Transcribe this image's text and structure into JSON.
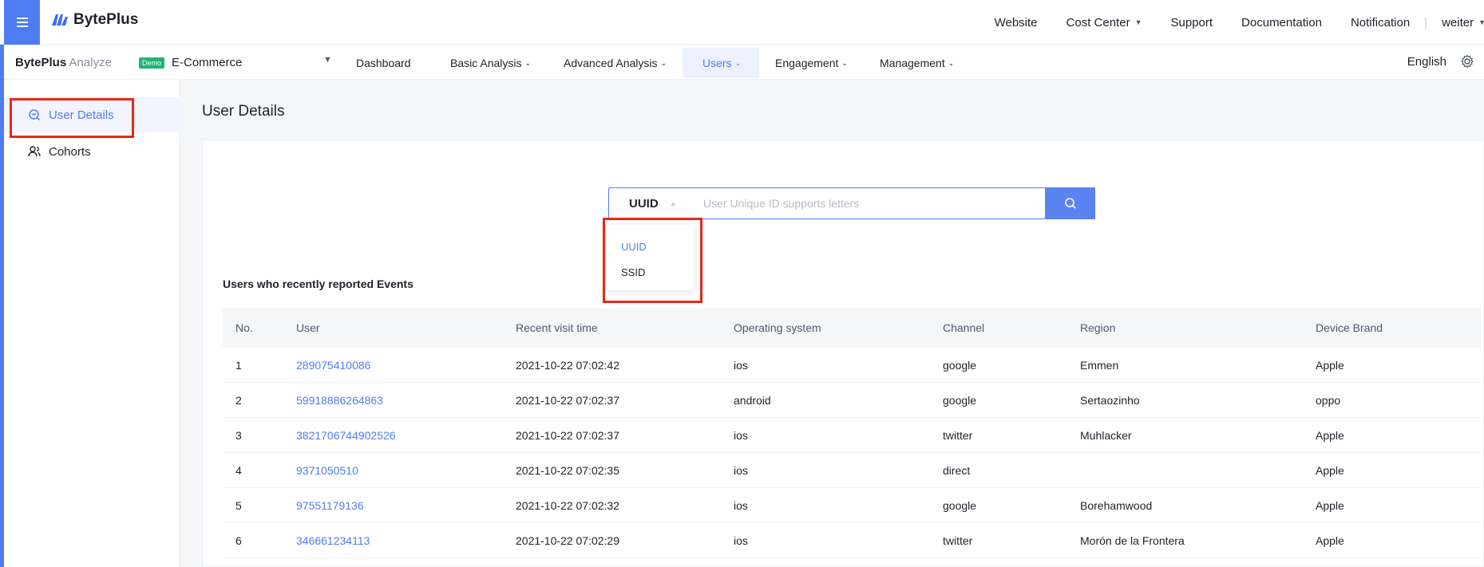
{
  "topbar": {
    "logo_text": "BytePlus",
    "nav": [
      {
        "label": "Website",
        "caret": false
      },
      {
        "label": "Cost Center",
        "caret": true
      },
      {
        "label": "Support",
        "caret": false
      },
      {
        "label": "Documentation",
        "caret": false
      },
      {
        "label": "Notification",
        "caret": false
      }
    ],
    "separator": "|",
    "user": "weiter"
  },
  "subbar": {
    "brand_bold": "BytePlus",
    "brand_light": "Analyze",
    "demo_badge": "Demo",
    "project": "E-Commerce",
    "nav": [
      {
        "label": "Dashboard",
        "chevron": false,
        "active": false
      },
      {
        "label": "Basic Analysis",
        "chevron": true,
        "active": false
      },
      {
        "label": "Advanced Analysis",
        "chevron": true,
        "active": false
      },
      {
        "label": "Users",
        "chevron": true,
        "active": true
      },
      {
        "label": "Engagement",
        "chevron": true,
        "active": false
      },
      {
        "label": "Management",
        "chevron": true,
        "active": false
      }
    ],
    "language": "English"
  },
  "sidebar": {
    "items": [
      {
        "label": "User Details",
        "icon": "user-search-icon",
        "active": true
      },
      {
        "label": "Cohorts",
        "icon": "users-icon",
        "active": false
      }
    ]
  },
  "main": {
    "title": "User Details",
    "search": {
      "type": "UUID",
      "placeholder": "User Unique ID supports letters",
      "value": ""
    },
    "dropdown_options": [
      "UUID",
      "SSID"
    ],
    "selected_option": "UUID",
    "section_title": "Users who recently reported Events",
    "table": {
      "columns": [
        "No.",
        "User",
        "Recent visit time",
        "Operating system",
        "Channel",
        "Region",
        "Device Brand"
      ],
      "rows": [
        [
          "1",
          "289075410086",
          "2021-10-22 07:02:42",
          "ios",
          "google",
          "Emmen",
          "Apple"
        ],
        [
          "2",
          "59918886264863",
          "2021-10-22 07:02:37",
          "android",
          "google",
          "Sertaozinho",
          "oppo"
        ],
        [
          "3",
          "3821706744902526",
          "2021-10-22 07:02:37",
          "ios",
          "twitter",
          "Muhlacker",
          "Apple"
        ],
        [
          "4",
          "9371050510",
          "2021-10-22 07:02:35",
          "ios",
          "direct",
          "",
          "Apple"
        ],
        [
          "5",
          "97551179136",
          "2021-10-22 07:02:32",
          "ios",
          "google",
          "Borehamwood",
          "Apple"
        ],
        [
          "6",
          "346661234113",
          "2021-10-22 07:02:29",
          "ios",
          "twitter",
          "Morón de la Frontera",
          "Apple"
        ]
      ]
    }
  },
  "colors": {
    "accent": "#4e7cf2",
    "highlight": "#e5291b",
    "demo_badge": "#21b573"
  }
}
